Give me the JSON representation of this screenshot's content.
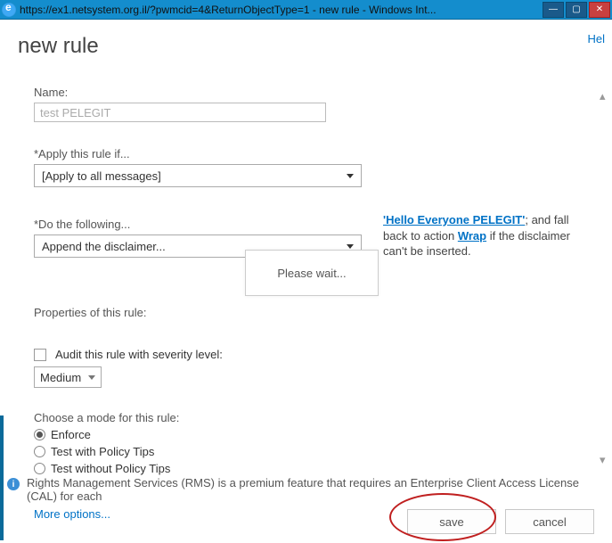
{
  "window": {
    "url_title": "https://ex1.netsystem.org.il/?pwmcid=4&ReturnObjectType=1 - new rule - Windows Int..."
  },
  "help": "Hel",
  "page_title": "new rule",
  "name": {
    "label": "Name:",
    "value": "test PELEGIT"
  },
  "apply_if": {
    "label": "*Apply this rule if...",
    "selected": "[Apply to all messages]"
  },
  "do_following": {
    "label": "*Do the following...",
    "selected": "Append the disclaimer..."
  },
  "side": {
    "bold": "'Hello Everyone PELEGIT'",
    "text1": "; and fall back to action ",
    "wrap": "Wrap",
    "text2": " if the disclaimer can't be inserted."
  },
  "loading": "Please wait...",
  "properties_label": "Properties of this rule:",
  "audit": {
    "label": "Audit this rule with severity level:",
    "severity": "Medium"
  },
  "mode": {
    "label": "Choose a mode for this rule:",
    "options": {
      "enforce": "Enforce",
      "test_tips": "Test with Policy Tips",
      "test_no_tips": "Test without Policy Tips"
    }
  },
  "more_options": "More options...",
  "info_text": "Rights Management Services (RMS) is a premium feature that requires an Enterprise Client Access License (CAL) for each",
  "buttons": {
    "save": "save",
    "cancel": "cancel"
  }
}
